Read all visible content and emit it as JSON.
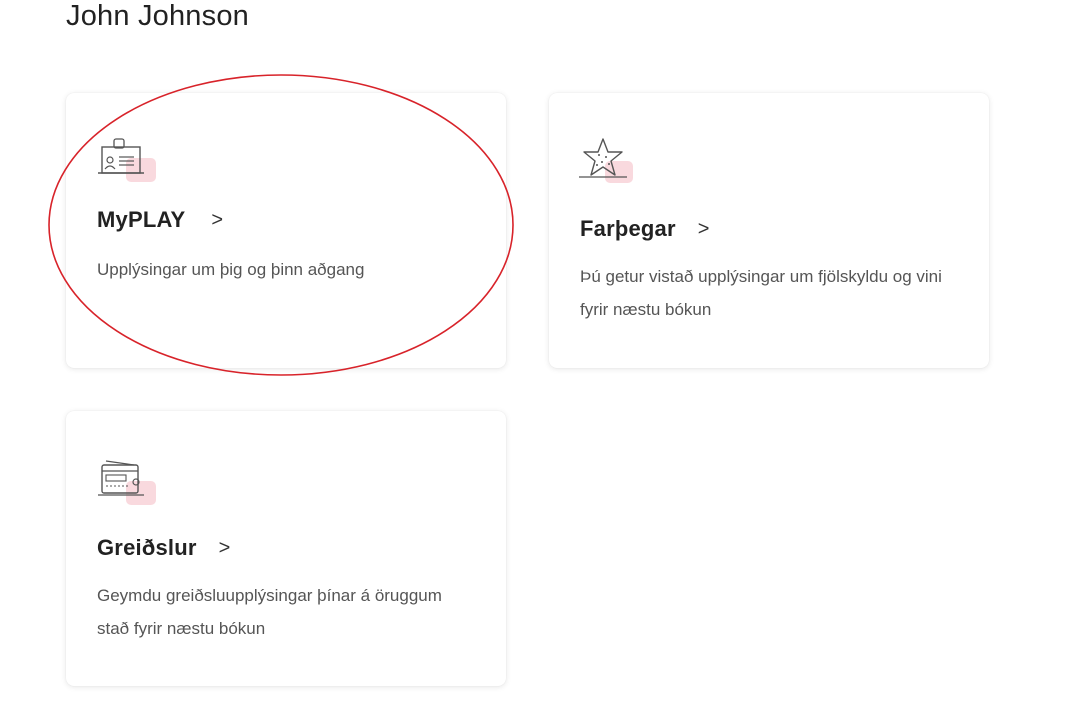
{
  "page": {
    "title": "John Johnson"
  },
  "cards": [
    {
      "icon": "id-card-icon",
      "title": "MyPLAY",
      "chevron": ">",
      "description": "Upplýsingar um þig og þinn aðgang"
    },
    {
      "icon": "star-icon",
      "title": "Farþegar",
      "chevron": ">",
      "description": "Þú getur vistað upplýsingar um fjölskyldu og vini fyrir næstu bókun"
    },
    {
      "icon": "payment-card-icon",
      "title": "Greiðslur",
      "chevron": ">",
      "description": "Geymdu greiðsluupplýsingar þínar á öruggum stað fyrir næstu bókun"
    }
  ],
  "colors": {
    "accent_pink": "#f6c9d0",
    "annotation_red": "#d8232a",
    "icon_stroke": "#555555"
  }
}
